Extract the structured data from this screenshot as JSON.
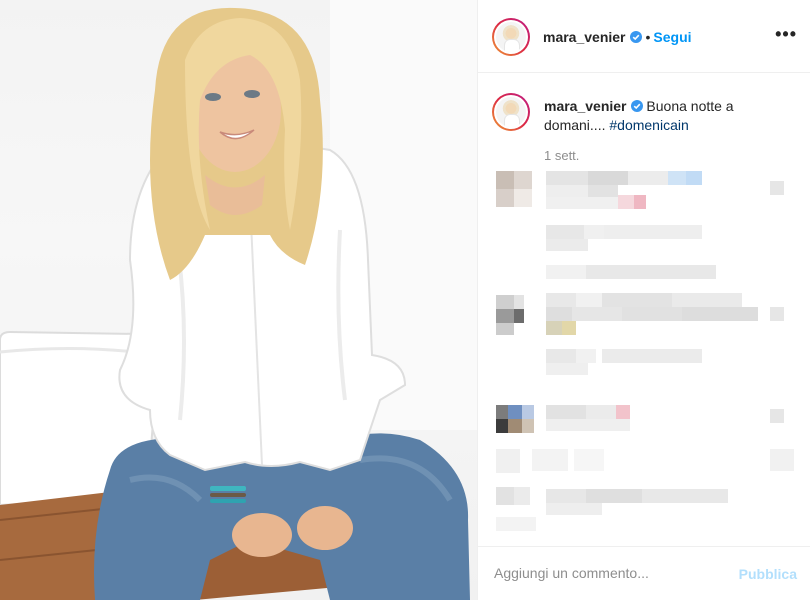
{
  "post": {
    "username": "mara_venier",
    "follow_label": "Segui",
    "dot": "•",
    "more_label": "•••",
    "caption_text": "Buona notte a domani.... ",
    "hashtag": "#domenicain",
    "time": "1 sett.",
    "comment_placeholder": "Aggiungi un commento...",
    "publish_label": "Pubblica"
  },
  "colors": {
    "accent": "#0095f6",
    "publish_disabled": "#b2dffc",
    "hashtag": "#00376b",
    "muted": "#8e8e8e"
  },
  "icons": {
    "verified": "verified-badge-icon",
    "more": "more-options-icon"
  }
}
